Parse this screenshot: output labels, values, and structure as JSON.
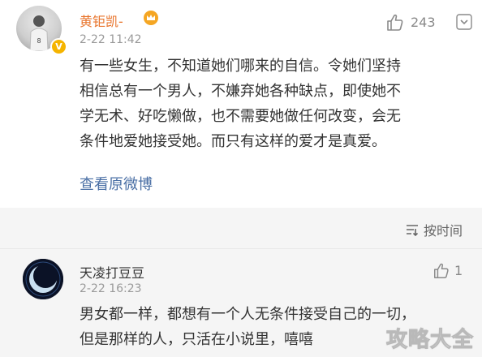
{
  "comment": {
    "user_name": "黄钜凯-",
    "timestamp": "2-22 11:42",
    "like_count": "243",
    "body_lines": [
      "有一些女生，不知道她们哪来的自信。令她们坚持",
      "相信总有一个男人，不嫌弃她各种缺点，即使她不",
      "学无术、好吃懒做，也不需要她做任何改变，会无",
      "条件地爱她接受她。而只有这样的爱才是真爱。"
    ],
    "view_original_label": "查看原微博",
    "verified_badge": "V"
  },
  "sort_label": "按时间",
  "reply": {
    "user_name": "天凌打豆豆",
    "timestamp": "2-22 16:23",
    "like_count": "1",
    "body_lines": [
      "男女都一样，都想有一个人无条件接受自己的一切，",
      "但是那样的人，只活在小说里，嘻嘻"
    ]
  },
  "watermark": "攻略大全",
  "icons": {
    "like": "thumbs-up-icon",
    "more": "chevron-down-icon",
    "sort": "sort-icon",
    "vip": "crown-icon"
  },
  "colors": {
    "username_vip": "#e8732a",
    "link": "#4a6fa5",
    "muted": "#9a9a9a"
  }
}
